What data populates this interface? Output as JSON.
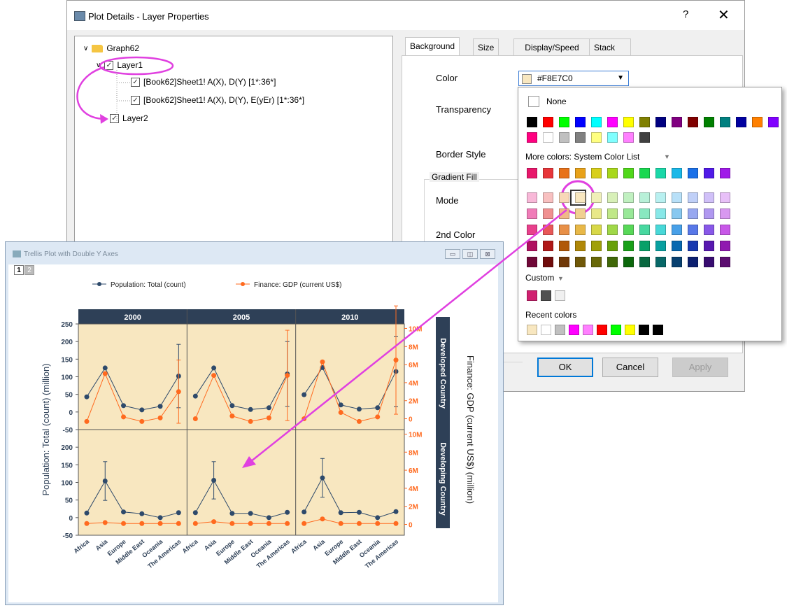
{
  "dialog": {
    "title": "Plot Details - Layer Properties",
    "help": "?",
    "close": "✕",
    "tree": {
      "root": "Graph62",
      "layer1": "Layer1",
      "plot1": "[Book62]Sheet1! A(X), D(Y) [1*:36*]",
      "plot2": "[Book62]Sheet1! A(X), D(Y), E(yEr) [1*:36*]",
      "layer2": "Layer2"
    },
    "tabs": [
      "Background",
      "Size",
      "Display/Speed",
      "Stack"
    ],
    "labels": {
      "color": "Color",
      "transparency": "Transparency",
      "border_style": "Border Style",
      "gradient_fill": "Gradient Fill",
      "mode": "Mode",
      "second_color": "2nd Color"
    },
    "color_value": "#F8E7C0",
    "buttons": {
      "ok": "OK",
      "cancel": "Cancel",
      "apply": "Apply"
    }
  },
  "color_popup": {
    "none_label": "None",
    "more_colors_label": "More colors: System Color List",
    "custom_label": "Custom",
    "recent_label": "Recent colors",
    "basic_row1": [
      "#000000",
      "#ff0000",
      "#00ff00",
      "#0000ff",
      "#00ffff",
      "#ff00ff",
      "#ffff00",
      "#808000",
      "#000080",
      "#800080",
      "#800000",
      "#008000",
      "#008080",
      "#0000a0",
      "#ff8000",
      "#8000ff"
    ],
    "basic_row2": [
      "#ff0080",
      "#ffffff",
      "#c0c0c0",
      "#808080",
      "#ffff80",
      "#80ffff",
      "#ff80ff",
      "#404040"
    ],
    "hue_row": [
      "#e8176b",
      "#e8363a",
      "#e8721a",
      "#e8a21a",
      "#d8cf1a",
      "#a8d81a",
      "#50d81a",
      "#1ad850",
      "#1ad8a8",
      "#1ab8e8",
      "#1a70e8",
      "#501ae8",
      "#a01ae8"
    ],
    "grid": [
      [
        "#f8b8d8",
        "#f8c0c0",
        "#f8d8b8",
        "#f8e7c0",
        "#f0f0b8",
        "#d8f0b8",
        "#c0f0c0",
        "#b8f0d8",
        "#b8f0f0",
        "#b8e0f8",
        "#c0d0f8",
        "#d0c0f8",
        "#e8c0f8"
      ],
      [
        "#f07cb8",
        "#f09090",
        "#f0b888",
        "#f0d090",
        "#e8e888",
        "#c0e888",
        "#98e898",
        "#88e8c0",
        "#88e8e8",
        "#88c8f0",
        "#98a8f0",
        "#b098f0",
        "#d898f0"
      ],
      [
        "#e8408c",
        "#e85858",
        "#e89048",
        "#e8b848",
        "#d8d848",
        "#a0d848",
        "#58d858",
        "#48d8a0",
        "#48d8d8",
        "#48a0e8",
        "#5878e8",
        "#8858e8",
        "#c858e8"
      ],
      [
        "#b01060",
        "#b01818",
        "#b05808",
        "#b08808",
        "#a0a008",
        "#68a008",
        "#18a018",
        "#08a068",
        "#08a0a0",
        "#0868b0",
        "#1838b0",
        "#5818b0",
        "#9018b0"
      ],
      [
        "#700838",
        "#700c0c",
        "#703808",
        "#705808",
        "#686808",
        "#406808",
        "#0c680c",
        "#086840",
        "#086868",
        "#084070",
        "#0c2070",
        "#380c70",
        "#5c0c70"
      ]
    ],
    "custom_colors": [
      "#d02070",
      "#505050",
      "#f0f0f0"
    ],
    "recent_colors": [
      "#f8e7c0",
      "#ffffff",
      "#c0c0c0",
      "#ff00ff",
      "#ff80ff",
      "#ff0000",
      "#00ff00",
      "#ffff00",
      "#000000",
      "#000000"
    ]
  },
  "plot_window": {
    "title": "Trellis Plot with Double Y Axes",
    "page_tabs": [
      "1",
      "2"
    ],
    "win_buttons": [
      "▭",
      "◫",
      "⊠"
    ]
  },
  "chart_data": {
    "type": "line",
    "legend": [
      "Population: Total (count)",
      "Finance: GDP (current US$)"
    ],
    "legend_position": "top",
    "column_headers": [
      "2000",
      "2005",
      "2010"
    ],
    "row_headers": [
      "Developed Country",
      "Developing Country"
    ],
    "categories": [
      "Africa",
      "Asia",
      "Europe",
      "Middle East",
      "Oceania",
      "The Americas"
    ],
    "ylabel_left": "Population: Total (count) (million)",
    "ylabel_right": "Finance: GDP (current US$) (million)",
    "left_ticks": [
      "250",
      "200",
      "150",
      "100",
      "50",
      "0",
      "-50"
    ],
    "right_ticks": [
      "10M",
      "8M",
      "6M",
      "4M",
      "2M",
      "0"
    ],
    "ylim_left": [
      -50,
      250
    ],
    "ylim_right": [
      -1.2,
      10.5
    ],
    "background": "#f8e7c0",
    "series_colors": [
      "#2e4a6b",
      "#ff6a1f"
    ],
    "panels": [
      {
        "row": 0,
        "col": 0,
        "population": [
          43,
          125,
          18,
          6,
          16,
          102
        ],
        "population_err": [
          0,
          0,
          0,
          0,
          0,
          90
        ],
        "gdp": [
          -0.3,
          5.0,
          0.2,
          -0.3,
          0.1,
          3.0
        ],
        "gdp_err": [
          0,
          0,
          0,
          0,
          0,
          3.5
        ]
      },
      {
        "row": 0,
        "col": 1,
        "population": [
          45,
          125,
          18,
          7,
          12,
          108
        ],
        "population_err": [
          0,
          0,
          0,
          0,
          0,
          92
        ],
        "gdp": [
          0.0,
          4.8,
          0.3,
          -0.3,
          0.1,
          4.8
        ],
        "gdp_err": [
          0,
          0,
          0,
          0,
          0,
          5.0
        ]
      },
      {
        "row": 0,
        "col": 2,
        "population": [
          49,
          126,
          20,
          8,
          12,
          115
        ],
        "population_err": [
          0,
          0,
          0,
          0,
          0,
          100
        ],
        "gdp": [
          0.0,
          6.3,
          0.7,
          -0.3,
          0.2,
          6.5
        ],
        "gdp_err": [
          0,
          0,
          0,
          0,
          0,
          6.0
        ]
      },
      {
        "row": 1,
        "col": 0,
        "population": [
          13,
          104,
          16,
          11,
          0,
          14
        ],
        "population_err": [
          0,
          55,
          0,
          0,
          0,
          0
        ],
        "gdp": [
          0.1,
          0.2,
          0.1,
          0.1,
          0.1,
          0.1
        ],
        "gdp_err": [
          0,
          0,
          0,
          0,
          0,
          0
        ]
      },
      {
        "row": 1,
        "col": 1,
        "population": [
          14,
          106,
          12,
          12,
          0,
          15
        ],
        "population_err": [
          0,
          53,
          0,
          0,
          0,
          0
        ],
        "gdp": [
          0.1,
          0.3,
          0.1,
          0.1,
          0.1,
          0.1
        ],
        "gdp_err": [
          0,
          0,
          0,
          0,
          0,
          0
        ]
      },
      {
        "row": 1,
        "col": 2,
        "population": [
          16,
          113,
          14,
          15,
          0,
          17
        ],
        "population_err": [
          0,
          55,
          0,
          0,
          0,
          0
        ],
        "gdp": [
          0.1,
          0.6,
          0.1,
          0.1,
          0.1,
          0.1
        ],
        "gdp_err": [
          0,
          0,
          0,
          0,
          0,
          0
        ]
      }
    ]
  }
}
